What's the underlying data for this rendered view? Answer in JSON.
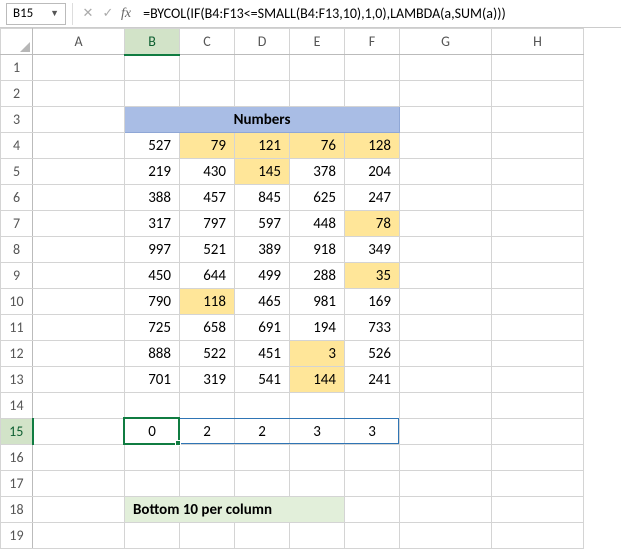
{
  "namebox": {
    "value": "B15"
  },
  "fx": {
    "label": "fx"
  },
  "formula": {
    "value": "=BYCOL(IF(B4:F13<=SMALL(B4:F13,10),1,0),LAMBDA(a,SUM(a)))"
  },
  "columns": [
    "A",
    "B",
    "C",
    "D",
    "E",
    "F",
    "G",
    "H"
  ],
  "rows": [
    "1",
    "2",
    "3",
    "4",
    "5",
    "6",
    "7",
    "8",
    "9",
    "10",
    "11",
    "12",
    "13",
    "14",
    "15",
    "16",
    "17",
    "18",
    "19"
  ],
  "header_label": "Numbers",
  "bottom_label": "Bottom 10 per column",
  "chart_data": {
    "type": "table",
    "title": "Numbers",
    "columns": [
      "B",
      "C",
      "D",
      "E",
      "F"
    ],
    "rows": [
      [
        527,
        79,
        121,
        76,
        128
      ],
      [
        219,
        430,
        145,
        378,
        204
      ],
      [
        388,
        457,
        845,
        625,
        247
      ],
      [
        317,
        797,
        597,
        448,
        78
      ],
      [
        997,
        521,
        389,
        918,
        349
      ],
      [
        450,
        644,
        499,
        288,
        35
      ],
      [
        790,
        118,
        465,
        981,
        169
      ],
      [
        725,
        658,
        691,
        194,
        733
      ],
      [
        888,
        522,
        451,
        3,
        526
      ],
      [
        701,
        319,
        541,
        144,
        241
      ]
    ],
    "highlights": [
      [
        false,
        true,
        true,
        true,
        true
      ],
      [
        false,
        false,
        true,
        false,
        false
      ],
      [
        false,
        false,
        false,
        false,
        false
      ],
      [
        false,
        false,
        false,
        false,
        true
      ],
      [
        false,
        false,
        false,
        false,
        false
      ],
      [
        false,
        false,
        false,
        false,
        true
      ],
      [
        false,
        true,
        false,
        false,
        false
      ],
      [
        false,
        false,
        false,
        false,
        false
      ],
      [
        false,
        false,
        false,
        true,
        false
      ],
      [
        false,
        false,
        false,
        true,
        false
      ]
    ],
    "summary_label": "Bottom 10 per column",
    "summary": [
      0,
      2,
      2,
      3,
      3
    ]
  }
}
